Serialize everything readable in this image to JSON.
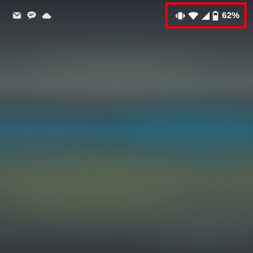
{
  "status_bar": {
    "notification_icons": [
      "gmail-icon",
      "chat-icon",
      "cloud-icon"
    ],
    "system_icons": [
      "vibrate-icon",
      "wifi-icon",
      "signal-icon",
      "battery-icon"
    ],
    "battery_percent_text": "62%",
    "battery_level": 0.62,
    "highlight_color": "#e8000b"
  },
  "wallpaper": {
    "colors": [
      "#2c3036",
      "#55605e",
      "#2d6070",
      "#546050",
      "#353b40"
    ]
  }
}
